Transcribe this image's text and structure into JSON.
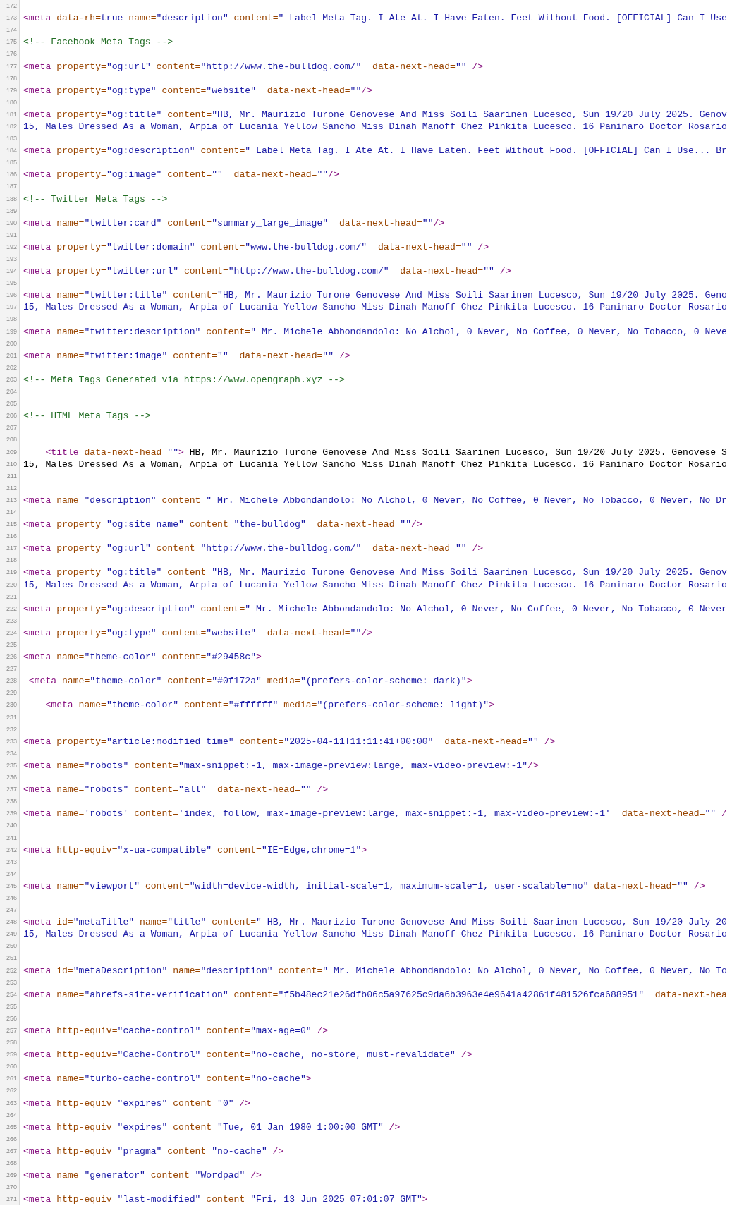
{
  "lines": [
    {
      "number": "172"
    },
    {
      "number": "173",
      "tokens": [
        {
          "kind": "tag",
          "text": "<meta"
        },
        {
          "kind": "attr",
          "text": " data-rh="
        },
        {
          "kind": "value",
          "text": "true"
        },
        {
          "kind": "attr",
          "text": " name="
        },
        {
          "kind": "value",
          "text": "\"description\""
        },
        {
          "kind": "attr",
          "text": " content="
        },
        {
          "kind": "value",
          "text": "\" Label Meta Tag. I Ate At. I Have Eaten. Feet Without Food. [OFFICIAL] Can I Use"
        }
      ]
    },
    {
      "number": "174"
    },
    {
      "number": "175",
      "tokens": [
        {
          "kind": "comment",
          "text": "<!-- Facebook Meta Tags -->"
        }
      ]
    },
    {
      "number": "176"
    },
    {
      "number": "177",
      "tokens": [
        {
          "kind": "tag",
          "text": "<meta"
        },
        {
          "kind": "attr",
          "text": " property="
        },
        {
          "kind": "value",
          "text": "\"og:url\""
        },
        {
          "kind": "attr",
          "text": " content="
        },
        {
          "kind": "value",
          "text": "\"http://www.the-bulldog.com/\""
        },
        {
          "kind": "attr",
          "text": "  data-next-head="
        },
        {
          "kind": "value",
          "text": "\"\""
        },
        {
          "kind": "tag",
          "text": " />"
        }
      ]
    },
    {
      "number": "178"
    },
    {
      "number": "179",
      "tokens": [
        {
          "kind": "tag",
          "text": "<meta"
        },
        {
          "kind": "attr",
          "text": " property="
        },
        {
          "kind": "value",
          "text": "\"og:type\""
        },
        {
          "kind": "attr",
          "text": " content="
        },
        {
          "kind": "value",
          "text": "\"website\""
        },
        {
          "kind": "attr",
          "text": "  data-next-head="
        },
        {
          "kind": "value",
          "text": "\"\""
        },
        {
          "kind": "tag",
          "text": "/>"
        }
      ]
    },
    {
      "number": "180"
    },
    {
      "number": "181",
      "tokens": [
        {
          "kind": "tag",
          "text": "<meta"
        },
        {
          "kind": "attr",
          "text": " property="
        },
        {
          "kind": "value",
          "text": "\"og:title\""
        },
        {
          "kind": "attr",
          "text": " content="
        },
        {
          "kind": "value",
          "text": "\"HB, Mr. Maurizio Turone Genovese And Miss Soili Saarinen Lucesco, Sun 19/20 July 2025. Genov"
        }
      ]
    },
    {
      "number": "182",
      "tokens": [
        {
          "kind": "value",
          "text": "15, Males Dressed As a Woman, Arpia of Lucania Yellow Sancho Miss Dinah Manoff Chez Pinkita Lucesco. 16 Paninaro Doctor Rosario"
        }
      ]
    },
    {
      "number": "183"
    },
    {
      "number": "184",
      "tokens": [
        {
          "kind": "tag",
          "text": "<meta"
        },
        {
          "kind": "attr",
          "text": " property="
        },
        {
          "kind": "value",
          "text": "\"og:description\""
        },
        {
          "kind": "attr",
          "text": " content="
        },
        {
          "kind": "value",
          "text": "\" Label Meta Tag. I Ate At. I Have Eaten. Feet Without Food. [OFFICIAL] Can I Use... Br"
        }
      ]
    },
    {
      "number": "185"
    },
    {
      "number": "186",
      "tokens": [
        {
          "kind": "tag",
          "text": "<meta"
        },
        {
          "kind": "attr",
          "text": " property="
        },
        {
          "kind": "value",
          "text": "\"og:image\""
        },
        {
          "kind": "attr",
          "text": " content="
        },
        {
          "kind": "value",
          "text": "\"\""
        },
        {
          "kind": "attr",
          "text": "  data-next-head="
        },
        {
          "kind": "value",
          "text": "\"\""
        },
        {
          "kind": "tag",
          "text": "/>"
        }
      ]
    },
    {
      "number": "187"
    },
    {
      "number": "188",
      "tokens": [
        {
          "kind": "comment",
          "text": "<!-- Twitter Meta Tags -->"
        }
      ]
    },
    {
      "number": "189"
    },
    {
      "number": "190",
      "tokens": [
        {
          "kind": "tag",
          "text": "<meta"
        },
        {
          "kind": "attr",
          "text": " name="
        },
        {
          "kind": "value",
          "text": "\"twitter:card\""
        },
        {
          "kind": "attr",
          "text": " content="
        },
        {
          "kind": "value",
          "text": "\"summary_large_image\""
        },
        {
          "kind": "attr",
          "text": "  data-next-head="
        },
        {
          "kind": "value",
          "text": "\"\""
        },
        {
          "kind": "tag",
          "text": "/>"
        }
      ]
    },
    {
      "number": "191"
    },
    {
      "number": "192",
      "tokens": [
        {
          "kind": "tag",
          "text": "<meta"
        },
        {
          "kind": "attr",
          "text": " property="
        },
        {
          "kind": "value",
          "text": "\"twitter:domain\""
        },
        {
          "kind": "attr",
          "text": " content="
        },
        {
          "kind": "value",
          "text": "\"www.the-bulldog.com/\""
        },
        {
          "kind": "attr",
          "text": "  data-next-head="
        },
        {
          "kind": "value",
          "text": "\"\""
        },
        {
          "kind": "tag",
          "text": " />"
        }
      ]
    },
    {
      "number": "193"
    },
    {
      "number": "194",
      "tokens": [
        {
          "kind": "tag",
          "text": "<meta"
        },
        {
          "kind": "attr",
          "text": " property="
        },
        {
          "kind": "value",
          "text": "\"twitter:url\""
        },
        {
          "kind": "attr",
          "text": " content="
        },
        {
          "kind": "value",
          "text": "\"http://www.the-bulldog.com/\""
        },
        {
          "kind": "attr",
          "text": "  data-next-head="
        },
        {
          "kind": "value",
          "text": "\"\""
        },
        {
          "kind": "tag",
          "text": " />"
        }
      ]
    },
    {
      "number": "195"
    },
    {
      "number": "196",
      "tokens": [
        {
          "kind": "tag",
          "text": "<meta"
        },
        {
          "kind": "attr",
          "text": " name="
        },
        {
          "kind": "value",
          "text": "\"twitter:title\""
        },
        {
          "kind": "attr",
          "text": " content="
        },
        {
          "kind": "value",
          "text": "\"HB, Mr. Maurizio Turone Genovese And Miss Soili Saarinen Lucesco, Sun 19/20 July 2025. Geno"
        }
      ]
    },
    {
      "number": "197",
      "tokens": [
        {
          "kind": "value",
          "text": "15, Males Dressed As a Woman, Arpia of Lucania Yellow Sancho Miss Dinah Manoff Chez Pinkita Lucesco. 16 Paninaro Doctor Rosario"
        }
      ]
    },
    {
      "number": "198"
    },
    {
      "number": "199",
      "tokens": [
        {
          "kind": "tag",
          "text": "<meta"
        },
        {
          "kind": "attr",
          "text": " name="
        },
        {
          "kind": "value",
          "text": "\"twitter:description\""
        },
        {
          "kind": "attr",
          "text": " content="
        },
        {
          "kind": "value",
          "text": "\" Mr. Michele Abbondandolo: No Alchol, 0 Never, No Coffee, 0 Never, No Tobacco, 0 Neve"
        }
      ]
    },
    {
      "number": "200"
    },
    {
      "number": "201",
      "tokens": [
        {
          "kind": "tag",
          "text": "<meta"
        },
        {
          "kind": "attr",
          "text": " name="
        },
        {
          "kind": "value",
          "text": "\"twitter:image\""
        },
        {
          "kind": "attr",
          "text": " content="
        },
        {
          "kind": "value",
          "text": "\"\""
        },
        {
          "kind": "attr",
          "text": "  data-next-head="
        },
        {
          "kind": "value",
          "text": "\"\""
        },
        {
          "kind": "tag",
          "text": " />"
        }
      ]
    },
    {
      "number": "202"
    },
    {
      "number": "203",
      "tokens": [
        {
          "kind": "comment",
          "text": "<!-- Meta Tags Generated via https://www.opengraph.xyz -->"
        }
      ]
    },
    {
      "number": "204"
    },
    {
      "number": "205"
    },
    {
      "number": "206",
      "tokens": [
        {
          "kind": "comment",
          "text": "<!-- HTML Meta Tags -->"
        }
      ]
    },
    {
      "number": "207"
    },
    {
      "number": "208"
    },
    {
      "number": "209",
      "tokens": [
        {
          "kind": "tag",
          "text": "    <title"
        },
        {
          "kind": "attr",
          "text": " data-next-head="
        },
        {
          "kind": "value",
          "text": "\"\""
        },
        {
          "kind": "tag",
          "text": ">"
        },
        {
          "kind": "text",
          "text": " HB, Mr. Maurizio Turone Genovese And Miss Soili Saarinen Lucesco, Sun 19/20 July 2025. Genovese S"
        }
      ]
    },
    {
      "number": "210",
      "tokens": [
        {
          "kind": "text",
          "text": "15, Males Dressed As a Woman, Arpia of Lucania Yellow Sancho Miss Dinah Manoff Chez Pinkita Lucesco. 16 Paninaro Doctor Rosario"
        }
      ]
    },
    {
      "number": "211"
    },
    {
      "number": "212"
    },
    {
      "number": "213",
      "tokens": [
        {
          "kind": "tag",
          "text": "<meta"
        },
        {
          "kind": "attr",
          "text": " name="
        },
        {
          "kind": "value",
          "text": "\"description\""
        },
        {
          "kind": "attr",
          "text": " content="
        },
        {
          "kind": "value",
          "text": "\" Mr. Michele Abbondandolo: No Alchol, 0 Never, No Coffee, 0 Never, No Tobacco, 0 Never, No Dr"
        }
      ]
    },
    {
      "number": "214"
    },
    {
      "number": "215",
      "tokens": [
        {
          "kind": "tag",
          "text": "<meta"
        },
        {
          "kind": "attr",
          "text": " property="
        },
        {
          "kind": "value",
          "text": "\"og:site_name\""
        },
        {
          "kind": "attr",
          "text": " content="
        },
        {
          "kind": "value",
          "text": "\"the-bulldog\""
        },
        {
          "kind": "attr",
          "text": "  data-next-head="
        },
        {
          "kind": "value",
          "text": "\"\""
        },
        {
          "kind": "tag",
          "text": "/>"
        }
      ]
    },
    {
      "number": "216"
    },
    {
      "number": "217",
      "tokens": [
        {
          "kind": "tag",
          "text": "<meta"
        },
        {
          "kind": "attr",
          "text": " property="
        },
        {
          "kind": "value",
          "text": "\"og:url\""
        },
        {
          "kind": "attr",
          "text": " content="
        },
        {
          "kind": "value",
          "text": "\"http://www.the-bulldog.com/\""
        },
        {
          "kind": "attr",
          "text": "  data-next-head="
        },
        {
          "kind": "value",
          "text": "\"\""
        },
        {
          "kind": "tag",
          "text": " />"
        }
      ]
    },
    {
      "number": "218"
    },
    {
      "number": "219",
      "tokens": [
        {
          "kind": "tag",
          "text": "<meta"
        },
        {
          "kind": "attr",
          "text": " property="
        },
        {
          "kind": "value",
          "text": "\"og:title\""
        },
        {
          "kind": "attr",
          "text": " content="
        },
        {
          "kind": "value",
          "text": "\"HB, Mr. Maurizio Turone Genovese And Miss Soili Saarinen Lucesco, Sun 19/20 July 2025. Genov"
        }
      ]
    },
    {
      "number": "220",
      "tokens": [
        {
          "kind": "value",
          "text": "15, Males Dressed As a Woman, Arpia of Lucania Yellow Sancho Miss Dinah Manoff Chez Pinkita Lucesco. 16 Paninaro Doctor Rosario"
        }
      ]
    },
    {
      "number": "221"
    },
    {
      "number": "222",
      "tokens": [
        {
          "kind": "tag",
          "text": "<meta"
        },
        {
          "kind": "attr",
          "text": " property="
        },
        {
          "kind": "value",
          "text": "\"og:description\""
        },
        {
          "kind": "attr",
          "text": " content="
        },
        {
          "kind": "value",
          "text": "\" Mr. Michele Abbondandolo: No Alchol, 0 Never, No Coffee, 0 Never, No Tobacco, 0 Never"
        }
      ]
    },
    {
      "number": "223"
    },
    {
      "number": "224",
      "tokens": [
        {
          "kind": "tag",
          "text": "<meta"
        },
        {
          "kind": "attr",
          "text": " property="
        },
        {
          "kind": "value",
          "text": "\"og:type\""
        },
        {
          "kind": "attr",
          "text": " content="
        },
        {
          "kind": "value",
          "text": "\"website\""
        },
        {
          "kind": "attr",
          "text": "  data-next-head="
        },
        {
          "kind": "value",
          "text": "\"\""
        },
        {
          "kind": "tag",
          "text": "/>"
        }
      ]
    },
    {
      "number": "225"
    },
    {
      "number": "226",
      "tokens": [
        {
          "kind": "tag",
          "text": "<meta"
        },
        {
          "kind": "attr",
          "text": " name="
        },
        {
          "kind": "value",
          "text": "\"theme-color\""
        },
        {
          "kind": "attr",
          "text": " content="
        },
        {
          "kind": "value",
          "text": "\"#29458c\""
        },
        {
          "kind": "tag",
          "text": ">"
        }
      ]
    },
    {
      "number": "227"
    },
    {
      "number": "228",
      "tokens": [
        {
          "kind": "tag",
          "text": " <meta"
        },
        {
          "kind": "attr",
          "text": " name="
        },
        {
          "kind": "value",
          "text": "\"theme-color\""
        },
        {
          "kind": "attr",
          "text": " content="
        },
        {
          "kind": "value",
          "text": "\"#0f172a\""
        },
        {
          "kind": "attr",
          "text": " media="
        },
        {
          "kind": "value",
          "text": "\"(prefers-color-scheme: dark)\""
        },
        {
          "kind": "tag",
          "text": ">"
        }
      ]
    },
    {
      "number": "229"
    },
    {
      "number": "230",
      "tokens": [
        {
          "kind": "tag",
          "text": "    <meta"
        },
        {
          "kind": "attr",
          "text": " name="
        },
        {
          "kind": "value",
          "text": "\"theme-color\""
        },
        {
          "kind": "attr",
          "text": " content="
        },
        {
          "kind": "value",
          "text": "\"#ffffff\""
        },
        {
          "kind": "attr",
          "text": " media="
        },
        {
          "kind": "value",
          "text": "\"(prefers-color-scheme: light)\""
        },
        {
          "kind": "tag",
          "text": ">"
        }
      ]
    },
    {
      "number": "231"
    },
    {
      "number": "232"
    },
    {
      "number": "233",
      "tokens": [
        {
          "kind": "tag",
          "text": "<meta"
        },
        {
          "kind": "attr",
          "text": " property="
        },
        {
          "kind": "value",
          "text": "\"article:modified_time\""
        },
        {
          "kind": "attr",
          "text": " content="
        },
        {
          "kind": "value",
          "text": "\"2025-04-11T11:11:41+00:00\""
        },
        {
          "kind": "attr",
          "text": "  data-next-head="
        },
        {
          "kind": "value",
          "text": "\"\""
        },
        {
          "kind": "tag",
          "text": " />"
        }
      ]
    },
    {
      "number": "234"
    },
    {
      "number": "235",
      "tokens": [
        {
          "kind": "tag",
          "text": "<meta"
        },
        {
          "kind": "attr",
          "text": " name="
        },
        {
          "kind": "value",
          "text": "\"robots\""
        },
        {
          "kind": "attr",
          "text": " content="
        },
        {
          "kind": "value",
          "text": "\"max-snippet:-1, max-image-preview:large, max-video-preview:-1\""
        },
        {
          "kind": "tag",
          "text": "/>"
        }
      ]
    },
    {
      "number": "236"
    },
    {
      "number": "237",
      "tokens": [
        {
          "kind": "tag",
          "text": "<meta"
        },
        {
          "kind": "attr",
          "text": " name="
        },
        {
          "kind": "value",
          "text": "\"robots\""
        },
        {
          "kind": "attr",
          "text": " content="
        },
        {
          "kind": "value",
          "text": "\"all\""
        },
        {
          "kind": "attr",
          "text": "  data-next-head="
        },
        {
          "kind": "value",
          "text": "\"\""
        },
        {
          "kind": "tag",
          "text": " />"
        }
      ]
    },
    {
      "number": "238"
    },
    {
      "number": "239",
      "tokens": [
        {
          "kind": "tag",
          "text": "<meta"
        },
        {
          "kind": "attr",
          "text": " name="
        },
        {
          "kind": "value",
          "text": "'robots'"
        },
        {
          "kind": "attr",
          "text": " content="
        },
        {
          "kind": "value",
          "text": "'index, follow, max-image-preview:large, max-snippet:-1, max-video-preview:-1'"
        },
        {
          "kind": "attr",
          "text": "  data-next-head="
        },
        {
          "kind": "value",
          "text": "\"\""
        },
        {
          "kind": "tag",
          "text": " /"
        }
      ]
    },
    {
      "number": "240"
    },
    {
      "number": "241"
    },
    {
      "number": "242",
      "tokens": [
        {
          "kind": "tag",
          "text": "<meta"
        },
        {
          "kind": "attr",
          "text": " http-equiv="
        },
        {
          "kind": "value",
          "text": "\"x-ua-compatible\""
        },
        {
          "kind": "attr",
          "text": " content="
        },
        {
          "kind": "value",
          "text": "\"IE=Edge,chrome=1\""
        },
        {
          "kind": "tag",
          "text": ">"
        }
      ]
    },
    {
      "number": "243"
    },
    {
      "number": "244"
    },
    {
      "number": "245",
      "tokens": [
        {
          "kind": "tag",
          "text": "<meta"
        },
        {
          "kind": "attr",
          "text": " name="
        },
        {
          "kind": "value",
          "text": "\"viewport\""
        },
        {
          "kind": "attr",
          "text": " content="
        },
        {
          "kind": "value",
          "text": "\"width=device-width, initial-scale=1, maximum-scale=1, user-scalable=no\""
        },
        {
          "kind": "attr",
          "text": " data-next-head="
        },
        {
          "kind": "value",
          "text": "\"\""
        },
        {
          "kind": "tag",
          "text": " />"
        }
      ]
    },
    {
      "number": "246"
    },
    {
      "number": "247"
    },
    {
      "number": "248",
      "tokens": [
        {
          "kind": "tag",
          "text": "<meta"
        },
        {
          "kind": "attr",
          "text": " id="
        },
        {
          "kind": "value",
          "text": "\"metaTitle\""
        },
        {
          "kind": "attr",
          "text": " name="
        },
        {
          "kind": "value",
          "text": "\"title\""
        },
        {
          "kind": "attr",
          "text": " content="
        },
        {
          "kind": "value",
          "text": "\" HB, Mr. Maurizio Turone Genovese And Miss Soili Saarinen Lucesco, Sun 19/20 July 20"
        }
      ]
    },
    {
      "number": "249",
      "tokens": [
        {
          "kind": "value",
          "text": "15, Males Dressed As a Woman, Arpia of Lucania Yellow Sancho Miss Dinah Manoff Chez Pinkita Lucesco. 16 Paninaro Doctor Rosario"
        }
      ]
    },
    {
      "number": "250"
    },
    {
      "number": "251"
    },
    {
      "number": "252",
      "tokens": [
        {
          "kind": "tag",
          "text": "<meta"
        },
        {
          "kind": "attr",
          "text": " id="
        },
        {
          "kind": "value",
          "text": "\"metaDescription\""
        },
        {
          "kind": "attr",
          "text": " name="
        },
        {
          "kind": "value",
          "text": "\"description\""
        },
        {
          "kind": "attr",
          "text": " content="
        },
        {
          "kind": "value",
          "text": "\" Mr. Michele Abbondandolo: No Alchol, 0 Never, No Coffee, 0 Never, No To"
        }
      ]
    },
    {
      "number": "253"
    },
    {
      "number": "254",
      "tokens": [
        {
          "kind": "tag",
          "text": "<meta"
        },
        {
          "kind": "attr",
          "text": " name="
        },
        {
          "kind": "value",
          "text": "\"ahrefs-site-verification\""
        },
        {
          "kind": "attr",
          "text": " content="
        },
        {
          "kind": "value",
          "text": "\"f5b48ec21e26dfb06c5a97625c9da6b3963e4e9641a42861f481526fca688951\""
        },
        {
          "kind": "attr",
          "text": "  data-next-hea"
        }
      ]
    },
    {
      "number": "255"
    },
    {
      "number": "256"
    },
    {
      "number": "257",
      "tokens": [
        {
          "kind": "tag",
          "text": "<meta"
        },
        {
          "kind": "attr",
          "text": " http-equiv="
        },
        {
          "kind": "value",
          "text": "\"cache-control\""
        },
        {
          "kind": "attr",
          "text": " content="
        },
        {
          "kind": "value",
          "text": "\"max-age=0\""
        },
        {
          "kind": "tag",
          "text": " />"
        }
      ]
    },
    {
      "number": "258"
    },
    {
      "number": "259",
      "tokens": [
        {
          "kind": "tag",
          "text": "<meta"
        },
        {
          "kind": "attr",
          "text": " http-equiv="
        },
        {
          "kind": "value",
          "text": "\"Cache-Control\""
        },
        {
          "kind": "attr",
          "text": " content="
        },
        {
          "kind": "value",
          "text": "\"no-cache, no-store, must-revalidate\""
        },
        {
          "kind": "tag",
          "text": " />"
        }
      ]
    },
    {
      "number": "260"
    },
    {
      "number": "261",
      "tokens": [
        {
          "kind": "tag",
          "text": "<meta"
        },
        {
          "kind": "attr",
          "text": " name="
        },
        {
          "kind": "value",
          "text": "\"turbo-cache-control\""
        },
        {
          "kind": "attr",
          "text": " content="
        },
        {
          "kind": "value",
          "text": "\"no-cache\""
        },
        {
          "kind": "tag",
          "text": ">"
        }
      ]
    },
    {
      "number": "262"
    },
    {
      "number": "263",
      "tokens": [
        {
          "kind": "tag",
          "text": "<meta"
        },
        {
          "kind": "attr",
          "text": " http-equiv="
        },
        {
          "kind": "value",
          "text": "\"expires\""
        },
        {
          "kind": "attr",
          "text": " content="
        },
        {
          "kind": "value",
          "text": "\"0\""
        },
        {
          "kind": "tag",
          "text": " />"
        }
      ]
    },
    {
      "number": "264"
    },
    {
      "number": "265",
      "tokens": [
        {
          "kind": "tag",
          "text": "<meta"
        },
        {
          "kind": "attr",
          "text": " http-equiv="
        },
        {
          "kind": "value",
          "text": "\"expires\""
        },
        {
          "kind": "attr",
          "text": " content="
        },
        {
          "kind": "value",
          "text": "\"Tue, 01 Jan 1980 1:00:00 GMT\""
        },
        {
          "kind": "tag",
          "text": " />"
        }
      ]
    },
    {
      "number": "266"
    },
    {
      "number": "267",
      "tokens": [
        {
          "kind": "tag",
          "text": "<meta"
        },
        {
          "kind": "attr",
          "text": " http-equiv="
        },
        {
          "kind": "value",
          "text": "\"pragma\""
        },
        {
          "kind": "attr",
          "text": " content="
        },
        {
          "kind": "value",
          "text": "\"no-cache\""
        },
        {
          "kind": "tag",
          "text": " />"
        }
      ]
    },
    {
      "number": "268"
    },
    {
      "number": "269",
      "tokens": [
        {
          "kind": "tag",
          "text": "<meta"
        },
        {
          "kind": "attr",
          "text": " name="
        },
        {
          "kind": "value",
          "text": "\"generator\""
        },
        {
          "kind": "attr",
          "text": " content="
        },
        {
          "kind": "value",
          "text": "\"Wordpad\""
        },
        {
          "kind": "tag",
          "text": " />"
        }
      ]
    },
    {
      "number": "270"
    },
    {
      "number": "271",
      "tokens": [
        {
          "kind": "tag",
          "text": "<meta"
        },
        {
          "kind": "attr",
          "text": " http-equiv="
        },
        {
          "kind": "value",
          "text": "\"last-modified\""
        },
        {
          "kind": "attr",
          "text": " content="
        },
        {
          "kind": "value",
          "text": "\"Fri, 13 Jun 2025 07:01:07 GMT\""
        },
        {
          "kind": "tag",
          "text": ">"
        }
      ]
    }
  ]
}
